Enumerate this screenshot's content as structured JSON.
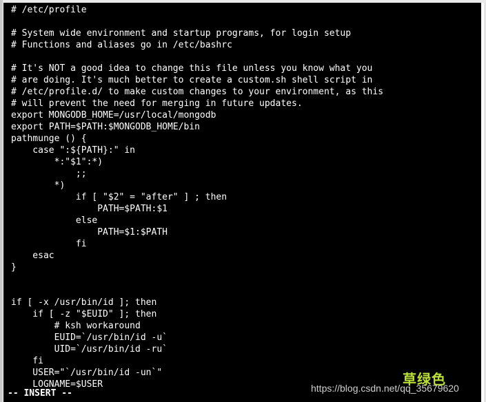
{
  "editor": {
    "lines": [
      "# /etc/profile",
      "",
      "# System wide environment and startup programs, for login setup",
      "# Functions and aliases go in /etc/bashrc",
      "",
      "# It's NOT a good idea to change this file unless you know what you",
      "# are doing. It's much better to create a custom.sh shell script in",
      "# /etc/profile.d/ to make custom changes to your environment, as this",
      "# will prevent the need for merging in future updates.",
      "export MONGODB_HOME=/usr/local/mongodb",
      "export PATH=$PATH:$MONGODB_HOME/bin",
      "pathmunge () {",
      "    case \":${PATH}:\" in",
      "        *:\"$1\":*)",
      "            ;;",
      "        *)",
      "            if [ \"$2\" = \"after\" ] ; then",
      "                PATH=$PATH:$1",
      "            else",
      "                PATH=$1:$PATH",
      "            fi",
      "    esac",
      "}",
      "",
      "",
      "if [ -x /usr/bin/id ]; then",
      "    if [ -z \"$EUID\" ]; then",
      "        # ksh workaround",
      "        EUID=`/usr/bin/id -u`",
      "        UID=`/usr/bin/id -ru`",
      "    fi",
      "    USER=\"`/usr/bin/id -un`\"",
      "    LOGNAME=$USER"
    ],
    "mode": "-- INSERT --"
  },
  "watermark": {
    "brand": "草绿色",
    "url": "https://blog.csdn.net/qq_35679620"
  },
  "colors": {
    "background": "#000000",
    "text": "#ffffff",
    "brand": "#b9df3c"
  }
}
